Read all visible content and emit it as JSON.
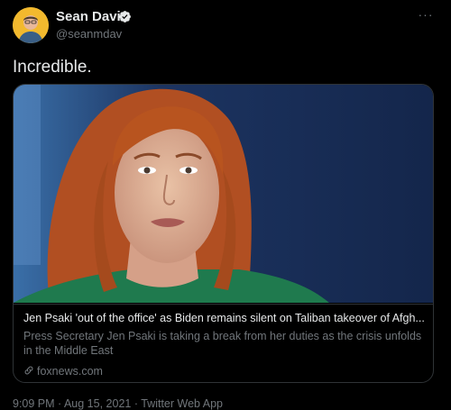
{
  "author": {
    "name": "Sean Davis",
    "handle": "@seanmdav",
    "avatar_icon": "person-avatar-icon",
    "verified_icon": "verified-badge-icon"
  },
  "more_icon": "more-options-icon",
  "tweet_text": "Incredible.",
  "link_card": {
    "image_icon": "article-photo",
    "title": "Jen Psaki 'out of the office' as Biden remains silent on Taliban takeover of Afgh...",
    "description": "Press Secretary Jen Psaki is taking a break from her duties as the crisis unfolds in the Middle East",
    "domain": "foxnews.com",
    "domain_icon": "link-icon"
  },
  "meta": {
    "timestamp": "9:09 PM · Aug 15, 2021 · Twitter Web App"
  },
  "colors": {
    "background": "#000000",
    "text_primary": "#e7e9ea",
    "text_secondary": "#71767b",
    "border": "#2f3336",
    "verified": "#1d9bf0"
  }
}
